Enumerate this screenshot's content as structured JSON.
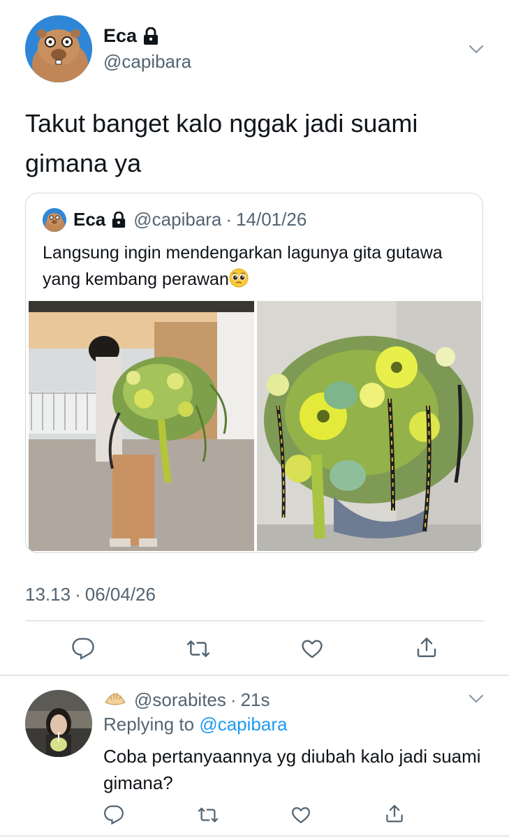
{
  "main_tweet": {
    "display_name": "Eca",
    "handle": "@capibara",
    "text": "Takut banget kalo nggak jadi suami gimana ya",
    "timestamp_time": "13.13",
    "timestamp_sep": "·",
    "timestamp_date": "06/04/26"
  },
  "quoted_tweet": {
    "display_name": "Eca",
    "handle": "@capibara",
    "dot": "·",
    "date": "14/01/26",
    "text": "Langsung ingin mendengarkan lagunya gita gutawa yang kembang perawan"
  },
  "actions": [
    "reply-icon",
    "retweet-icon",
    "like-icon",
    "share-icon"
  ],
  "reply_tweet": {
    "handle": "@sorabites",
    "dot": "·",
    "time": "21s",
    "replying_prefix": "Replying to",
    "replying_mention": "@capibara",
    "text": "Coba pertanyaannya yg diubah kalo jadi suami gimana?"
  },
  "colors": {
    "accent": "#1d9bf0",
    "secondary_text": "#536471",
    "border": "#cfd9de"
  }
}
